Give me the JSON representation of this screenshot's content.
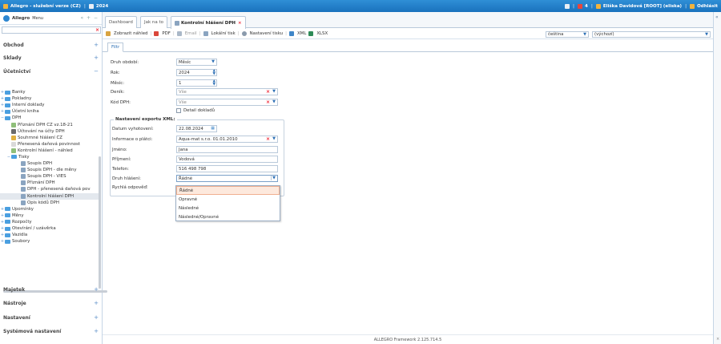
{
  "topbar": {
    "app_title": "Allegro - služební verze (CZ)",
    "year": "2024",
    "notif_count": "4",
    "user": "Eliška Davidová [ROOT] (eliska)",
    "logout": "Odhlásit"
  },
  "sidebar": {
    "title": "Allegro",
    "menu_label": "Menu",
    "controls": "« + −",
    "sections": {
      "obchod": "Obchod",
      "sklady": "Sklady",
      "ucetnictvi": "Účetnictví",
      "majetek": "Majetek",
      "nastroje": "Nástroje",
      "nastaveni": "Nastavení",
      "systemova": "Systémová nastavení"
    },
    "tree": [
      {
        "label": "Banky"
      },
      {
        "label": "Pokladny"
      },
      {
        "label": "Interní doklady"
      },
      {
        "label": "Účetní kniha"
      },
      {
        "label": "DPH"
      },
      {
        "label": "Přiznání DPH CZ vz.18-21"
      },
      {
        "label": "Účtování na účty DPH"
      },
      {
        "label": "Souhrnné hlášení CZ"
      },
      {
        "label": "Přenesená daňová povinnost"
      },
      {
        "label": "Kontrolní hlášení - náhled"
      },
      {
        "label": "Tisky"
      },
      {
        "label": "Soupis DPH"
      },
      {
        "label": "Soupis DPH - dle měny"
      },
      {
        "label": "Soupis DPH - VIES"
      },
      {
        "label": "Přiznání DPH"
      },
      {
        "label": "DPH - přenesená daňová pov"
      },
      {
        "label": "Kontrolní hlášení DPH"
      },
      {
        "label": "Opis kódů DPH"
      },
      {
        "label": "Upomínky"
      },
      {
        "label": "Měny"
      },
      {
        "label": "Rozpočty"
      },
      {
        "label": "Otevírání / uzávěrka"
      },
      {
        "label": "Vazidla"
      },
      {
        "label": "Soubory"
      }
    ]
  },
  "tabs": [
    "Dashboard",
    "Jak na to",
    "Kontrolní hlášení DPH"
  ],
  "toolbar": {
    "preview": "Zobrazit náhled",
    "pdf": "PDF",
    "email": "Email",
    "local_print": "Lokální tisk",
    "print_settings": "Nastavení tisku",
    "xml": "XML",
    "xlsx": "XLSX",
    "language": "čeština",
    "default": "(výchozí)"
  },
  "subtab": "Filtr",
  "filter": {
    "druh_obdobi": {
      "label": "Druh období:",
      "value": "Měsíc"
    },
    "rok": {
      "label": "Rok:",
      "value": "2024"
    },
    "mesic": {
      "label": "Měsíc:",
      "value": "1"
    },
    "denik": {
      "label": "Deník:",
      "value": "Vše"
    },
    "kod_dph": {
      "label": "Kód DPH:",
      "value": "Vše"
    },
    "detail": "Detail dokladů"
  },
  "export": {
    "legend": "Nastavení exportu XML:",
    "datum": {
      "label": "Datum vyhotovení:",
      "value": "22.08.2024"
    },
    "informace": {
      "label": "Informace o plátci:",
      "value": "Aqua-mat s.r.o. 01.01.2010"
    },
    "jmeno": {
      "label": "Jméno:",
      "value": "Jana"
    },
    "prijmeni": {
      "label": "Příjmení:",
      "value": "Vodová"
    },
    "telefon": {
      "label": "Telefon:",
      "value": "516 498 798"
    },
    "druh": {
      "label": "Druh hlášení:",
      "value": "Řádné"
    },
    "rychla": {
      "label": "Rychlá odpověď:"
    }
  },
  "dropdown_options": [
    "Řádné",
    "Opravné",
    "Následné",
    "Následné/Opravné"
  ],
  "footer": "ALLEGRO Framework 2.125.714.5"
}
